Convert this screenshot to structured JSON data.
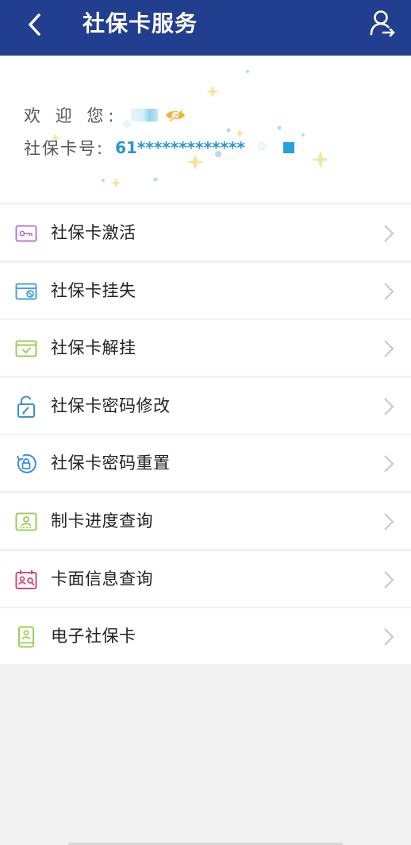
{
  "header": {
    "title": "社保卡服务",
    "background_color": "#223f8f",
    "back_icon": "chevron-left-icon",
    "right_icon": "user-switch-icon"
  },
  "info": {
    "welcome_label": "欢 迎 您:",
    "card_label": "社保卡号:",
    "card_number": "61*************",
    "eye_icon": "eye-hidden-icon",
    "accent_color": "#2c95cf",
    "eye_color": "#f0b43a"
  },
  "menu": {
    "items": [
      {
        "label": "社保卡激活",
        "icon": "card-activate-icon",
        "color": "#b67ed0"
      },
      {
        "label": "社保卡挂失",
        "icon": "card-report-loss-icon",
        "color": "#4aa3d9"
      },
      {
        "label": "社保卡解挂",
        "icon": "card-unlock-icon",
        "color": "#9ccf5a"
      },
      {
        "label": "社保卡密码修改",
        "icon": "password-edit-icon",
        "color": "#3d8fd6"
      },
      {
        "label": "社保卡密码重置",
        "icon": "password-reset-icon",
        "color": "#3d8fd6"
      },
      {
        "label": "制卡进度查询",
        "icon": "card-progress-icon",
        "color": "#9ccf5a"
      },
      {
        "label": "卡面信息查询",
        "icon": "card-face-search-icon",
        "color": "#d6487a"
      },
      {
        "label": "电子社保卡",
        "icon": "e-card-phone-icon",
        "color": "#9ccf5a"
      }
    ]
  }
}
